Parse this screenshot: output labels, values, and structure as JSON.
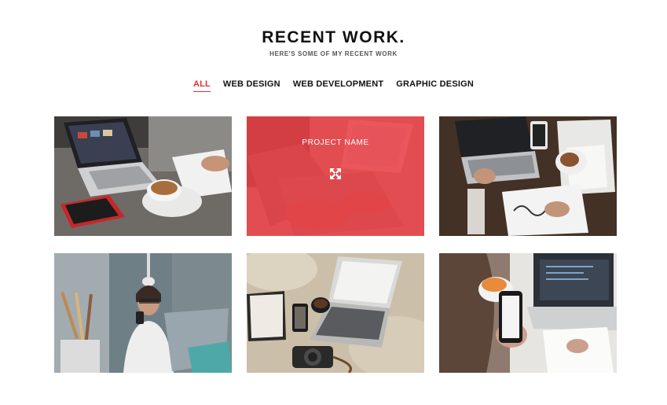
{
  "section": {
    "title": "RECENT WORK.",
    "subtitle": "HERE'S SOME OF MY RECENT WORK"
  },
  "filters": [
    {
      "label": "ALL",
      "active": true
    },
    {
      "label": "WEB DESIGN",
      "active": false
    },
    {
      "label": "WEB DEVELOPMENT",
      "active": false
    },
    {
      "label": "GRAPHIC DESIGN",
      "active": false
    }
  ],
  "portfolio": {
    "hover_label": "PROJECT NAME",
    "hover_icon": "expand-arrows-icon",
    "accent_color": "#e93c42",
    "items": [
      {
        "scene": "laptop-and-coffee-desk",
        "hovered": false
      },
      {
        "scene": "laptop-typing",
        "hovered": true
      },
      {
        "scene": "dark-desk-laptop-sketch",
        "hovered": false
      },
      {
        "scene": "woman-with-phone-studio",
        "hovered": false
      },
      {
        "scene": "bed-laptop-camera",
        "hovered": false
      },
      {
        "scene": "woman-phone-desk",
        "hovered": false
      }
    ]
  }
}
